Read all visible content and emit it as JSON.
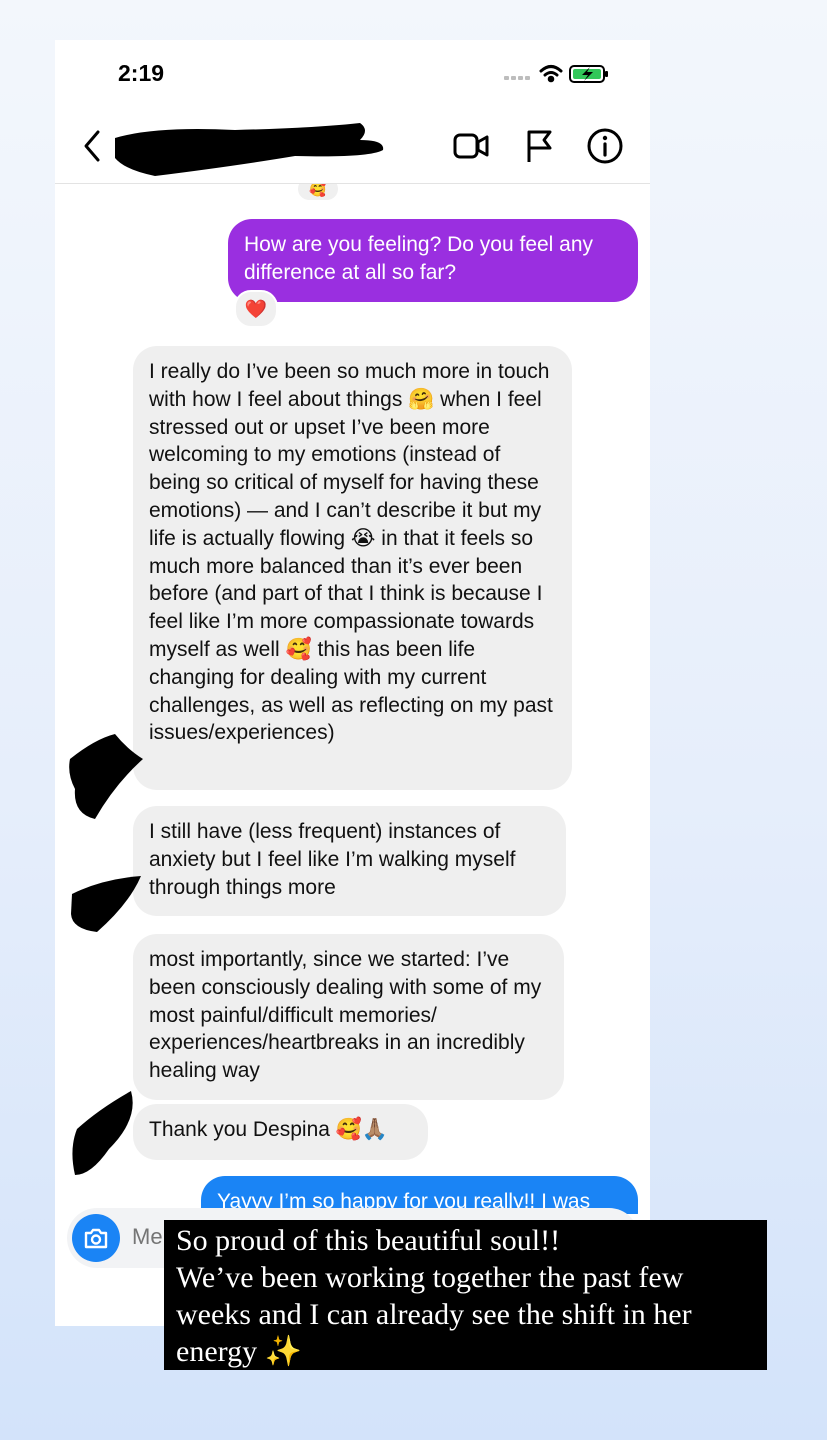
{
  "status_bar": {
    "time": "2:19"
  },
  "colors": {
    "outgoing_purple": "#9a2fe0",
    "outgoing_blue": "#1a84f5",
    "incoming_gray": "#efefef",
    "heart": "#e0162b"
  },
  "header": {
    "back_icon": "chevron-left-icon",
    "icons": [
      "video-camera-icon",
      "flag-icon",
      "info-icon"
    ]
  },
  "messages": [
    {
      "direction": "outgoing",
      "text": "How are you feeling? Do you feel any difference at all so far?",
      "reaction": "❤️"
    },
    {
      "direction": "incoming",
      "text": "I really do I’ve been so much more in touch with how I feel about things 🤗 when I feel stressed out or upset I’ve been more welcoming to my emotions (instead of being so critical of myself for having these emotions) — and I can’t describe it but my life is actually flowing 😭 in that it feels so much more balanced than it’s ever been before (and part of that I think is because I feel like I’m more compassionate towards myself as well 🥰 this has been life changing for dealing with my current challenges, as well as reflecting on my past issues/experiences)"
    },
    {
      "direction": "incoming",
      "text": "I still have (less frequent) instances of anxiety but I feel like I’m walking myself through things more"
    },
    {
      "direction": "incoming",
      "text": "most importantly, since we started: I’ve been consciously dealing with some of my most painful/difficult memories/ experiences/heartbreaks in an incredibly healing way"
    },
    {
      "direction": "incoming",
      "text": "Thank you Despina 🥰🙏🏽"
    },
    {
      "direction": "outgoing",
      "text": "Yayyy I’m so happy for you really!! I was"
    }
  ],
  "composer": {
    "placeholder": "Me"
  },
  "caption": {
    "text": "So proud of this beautiful soul!!\nWe’ve been working together the past few weeks and I can already see the shift in her energy ✨"
  }
}
